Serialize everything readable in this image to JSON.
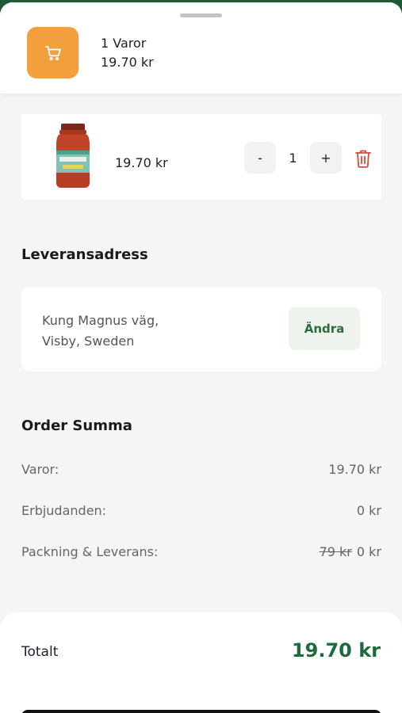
{
  "cart": {
    "count_label": "1 Varor",
    "total_label": "19.70 kr",
    "icon": "cart-icon",
    "accent": "#f2a03d"
  },
  "item": {
    "price": "19.70 kr",
    "quantity": "1",
    "minus_label": "-",
    "plus_label": "+",
    "image": "pasta-sauce-jar"
  },
  "address": {
    "title": "Leveransadress",
    "line1": "Kung Magnus väg,",
    "line2": "Visby, Sweden",
    "change_label": "Ändra"
  },
  "summary": {
    "title": "Order Summa",
    "rows": [
      {
        "label": "Varor:",
        "value": "19.70 kr"
      },
      {
        "label": "Erbjudanden:",
        "value": "0 kr"
      },
      {
        "label": "Packning & Leverans:",
        "old_value": "79 kr",
        "value": "0 kr"
      }
    ]
  },
  "footer": {
    "total_label": "Totalt",
    "total_value": "19.70 kr",
    "total_color": "#1f6a3c"
  }
}
